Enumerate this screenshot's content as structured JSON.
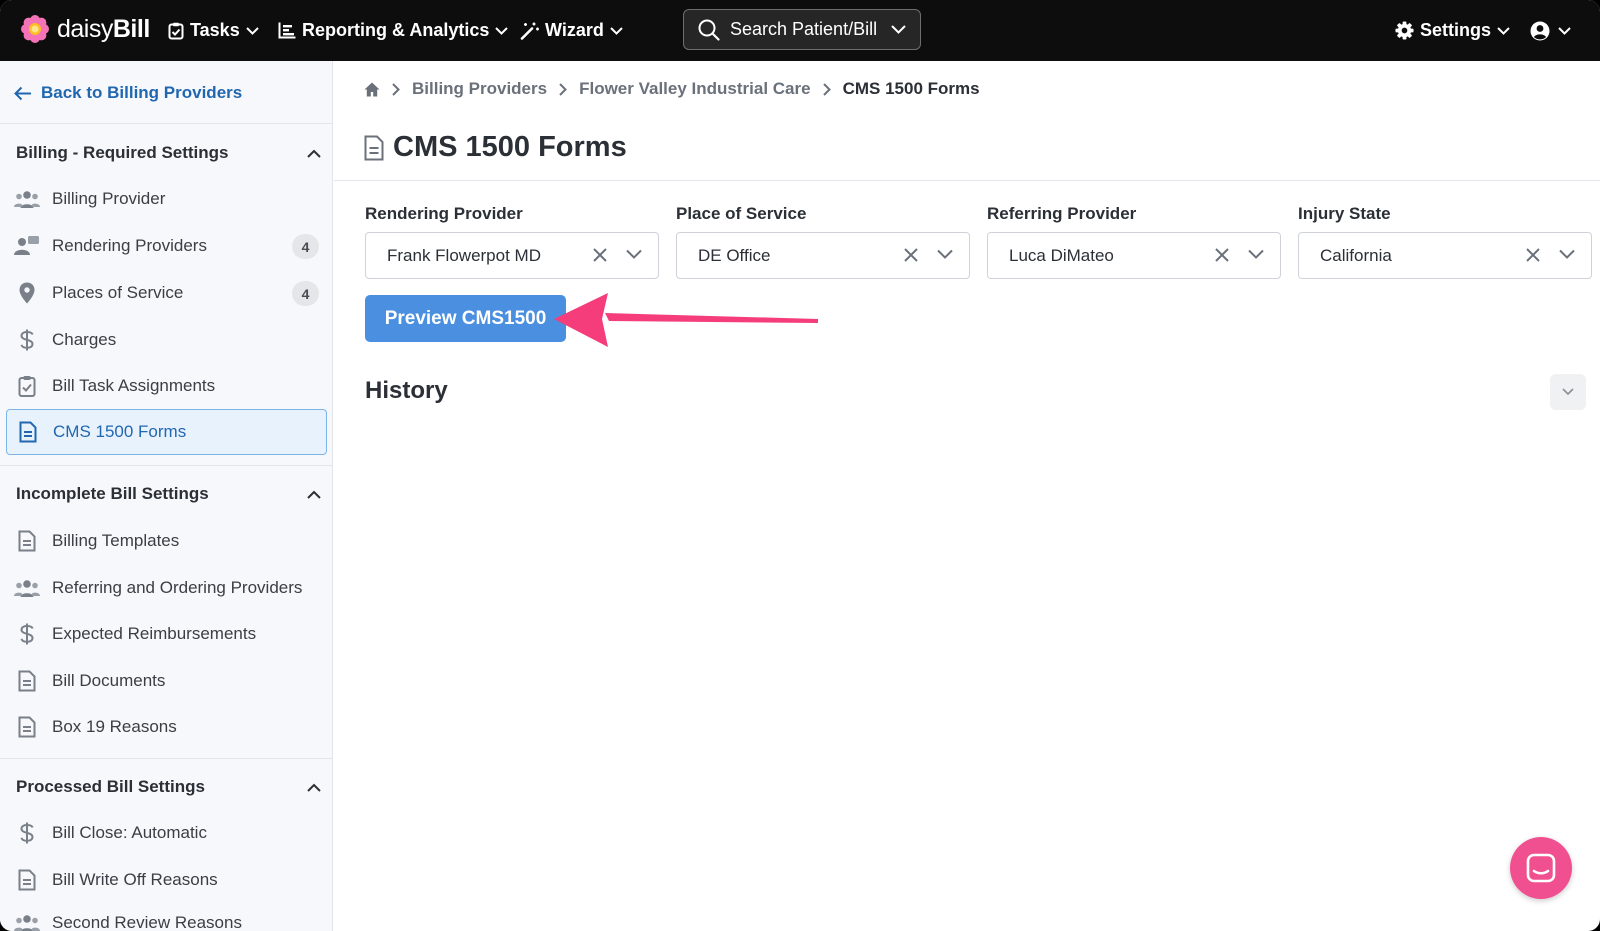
{
  "brand": {
    "name_light": "daisy",
    "name_bold": "Bill"
  },
  "topnav": {
    "tasks": "Tasks",
    "reporting": "Reporting & Analytics",
    "wizard": "Wizard",
    "search_label": "Search Patient/Bill",
    "settings": "Settings"
  },
  "sidebar": {
    "back": "Back to Billing Providers",
    "sections": [
      {
        "title": "Billing - Required Settings",
        "items": [
          {
            "label": "Billing Provider",
            "icon": "users-icon"
          },
          {
            "label": "Rendering Providers",
            "icon": "user-badge-icon",
            "count": "4"
          },
          {
            "label": "Places of Service",
            "icon": "map-pin-icon",
            "count": "4"
          },
          {
            "label": "Charges",
            "icon": "dollar-icon"
          },
          {
            "label": "Bill Task Assignments",
            "icon": "clipboard-check-icon"
          },
          {
            "label": "CMS 1500 Forms",
            "icon": "document-icon",
            "active": true
          }
        ]
      },
      {
        "title": "Incomplete Bill Settings",
        "items": [
          {
            "label": "Billing Templates",
            "icon": "document-icon"
          },
          {
            "label": "Referring and Ordering Providers",
            "icon": "users-icon"
          },
          {
            "label": "Expected Reimbursements",
            "icon": "dollar-icon"
          },
          {
            "label": "Bill Documents",
            "icon": "document-icon"
          },
          {
            "label": "Box 19 Reasons",
            "icon": "document-icon"
          }
        ]
      },
      {
        "title": "Processed Bill Settings",
        "items": [
          {
            "label": "Bill Close: Automatic",
            "icon": "dollar-icon"
          },
          {
            "label": "Bill Write Off Reasons",
            "icon": "document-icon"
          },
          {
            "label": "Second Review Reasons",
            "icon": "users-icon"
          }
        ]
      }
    ]
  },
  "breadcrumb": {
    "items": [
      "Billing Providers",
      "Flower Valley Industrial Care"
    ],
    "current": "CMS 1500 Forms"
  },
  "page": {
    "title": "CMS 1500 Forms"
  },
  "filters": [
    {
      "label": "Rendering Provider",
      "value": "Frank Flowerpot MD"
    },
    {
      "label": "Place of Service",
      "value": "DE Office"
    },
    {
      "label": "Referring Provider",
      "value": "Luca DiMateo"
    },
    {
      "label": "Injury State",
      "value": "California"
    }
  ],
  "actions": {
    "preview": "Preview CMS1500"
  },
  "history": {
    "title": "History"
  },
  "colors": {
    "accent": "#2167b0",
    "button": "#4a8fe0",
    "annotation": "#f43d7a",
    "chat": "#f0508f"
  }
}
